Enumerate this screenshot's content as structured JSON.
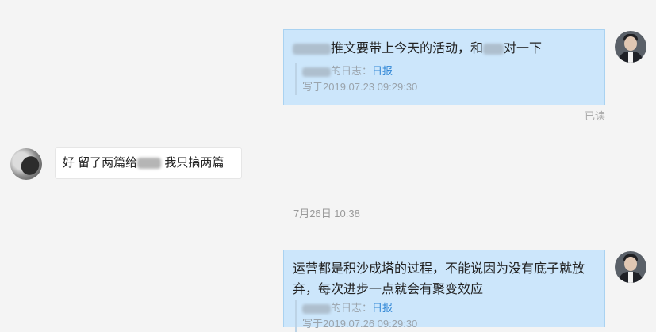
{
  "messages": [
    {
      "text_after": "推文要带上今天的活动，和",
      "text_end": "对一下",
      "quote_suffix": "的日志：",
      "quote_link": "日报",
      "quote_time": "写于2019.07.23 09:29:30",
      "status": "已读"
    },
    {
      "text_before": "好 留了两篇给",
      "text_after": "我只搞两篇"
    },
    {
      "line1": "运营都是积沙成塔的过程，不能说因为没有底子就放",
      "line2": "弃，每次进步一点就会有聚变效应",
      "quote_suffix": "的日志：",
      "quote_link": "日报",
      "quote_time": "写于2019.07.26 09:29:30"
    }
  ],
  "timestamp": "7月26日 10:38",
  "colors": {
    "background": "#f4f4f4",
    "my_bubble": "#cce6fb",
    "other_bubble": "#ffffff",
    "link": "#2f86d6"
  },
  "icons": [
    "user-avatar",
    "contact-avatar"
  ]
}
